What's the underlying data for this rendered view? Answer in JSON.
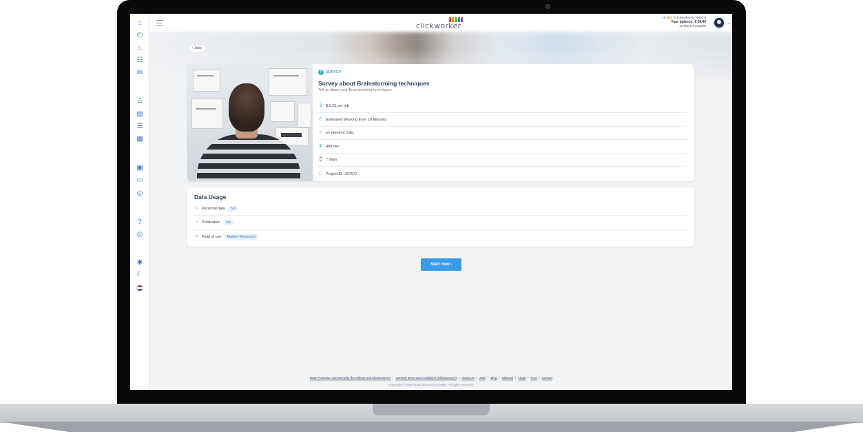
{
  "header": {
    "logo_text": "clickworker",
    "logo_colors": [
      "#e94e3c",
      "#f5a623",
      "#7ab648",
      "#3b7dd8",
      "#9b59b6"
    ],
    "greeting_prefix": "Hi",
    "user_name": "Max",
    "user_id_text": "(Clickworker-ID: 98001)",
    "balance_text": "Your balance: € 59.40",
    "payable_text": "22.00€ are payable"
  },
  "back": {
    "label": "‹ Jobs"
  },
  "job": {
    "category": "SURVEY",
    "title": "Survey about Brainstorming techniques",
    "subtitle": "Tell us about your Brainstorming techniques",
    "details": [
      {
        "icon": "money-icon",
        "glyph": "$",
        "text": "$ 3.25 per job"
      },
      {
        "icon": "clock-icon",
        "glyph": "◷",
        "text": "Estimated Working time: 10 Minutes"
      },
      {
        "icon": "hash-icon",
        "glyph": "#",
        "text": "on demand Jobs"
      },
      {
        "icon": "hourglass-icon",
        "glyph": "⧗",
        "text": "480 min"
      },
      {
        "icon": "calendar-icon",
        "glyph": "⌚",
        "text": "7 days"
      },
      {
        "icon": "id-icon",
        "glyph": "▢",
        "text": "Project ID: 367571"
      }
    ]
  },
  "usage": {
    "title": "Data Usage",
    "rows": [
      {
        "icon": "person-icon",
        "glyph": "☺",
        "label": "Personal data",
        "value": "No"
      },
      {
        "icon": "globe-icon",
        "glyph": "◔",
        "label": "Publication",
        "value": "No"
      },
      {
        "icon": "hash-icon",
        "glyph": "#",
        "label": "Field of use",
        "value": "Market Research"
      }
    ]
  },
  "start_button": {
    "label": "Start now ›"
  },
  "footer": {
    "links": [
      "Data Protection and Security (for Clients and Clickworkers)",
      "General terms and conditions (Clickworkers)",
      "About Us",
      "Jobs",
      "Blog",
      "Sitemap",
      "Legal",
      "FAQ",
      "Contact"
    ],
    "copyright": "Copyright © 2005-2023 clickworker GmbH. All rights reserved."
  },
  "sidebar": {
    "icons": [
      {
        "name": "jobs-icon",
        "glyph": "⌂"
      },
      {
        "name": "history-icon",
        "glyph": "◴"
      },
      {
        "name": "assessments-icon",
        "glyph": "♨"
      },
      {
        "name": "team-icon",
        "glyph": "☷"
      },
      {
        "name": "announcements-icon",
        "glyph": "✉"
      },
      {
        "name": "profile-icon",
        "glyph": "♙"
      },
      {
        "name": "qualifications-icon",
        "glyph": "▤"
      },
      {
        "name": "settings-icon",
        "glyph": "☰"
      },
      {
        "name": "documents-icon",
        "glyph": "▦"
      },
      {
        "name": "payments-icon",
        "glyph": "▣"
      },
      {
        "name": "card-icon",
        "glyph": "▭"
      },
      {
        "name": "payout-history-icon",
        "glyph": "◵"
      },
      {
        "name": "help-icon",
        "glyph": "?"
      },
      {
        "name": "chat-icon",
        "glyph": "◎"
      },
      {
        "name": "accessibility-icon",
        "glyph": "✱"
      },
      {
        "name": "dark-mode-icon",
        "glyph": "☾"
      }
    ]
  }
}
